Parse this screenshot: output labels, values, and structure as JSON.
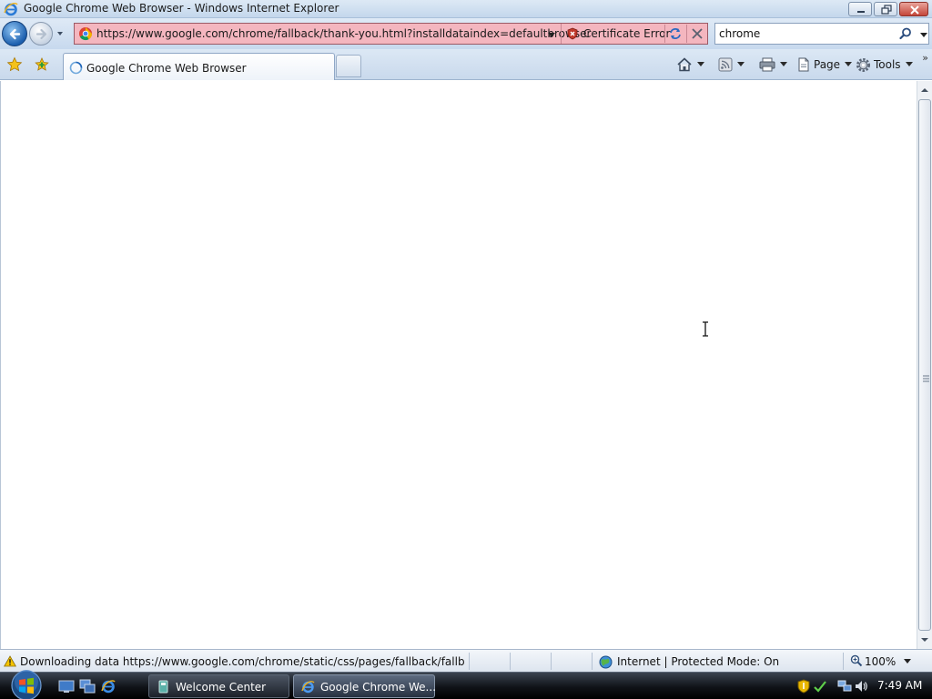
{
  "window": {
    "title": "Google Chrome Web Browser - Windows Internet Explorer"
  },
  "address_bar": {
    "url": "https://www.google.com/chrome/fallback/thank-you.html?installdataindex=defaultbrowser",
    "certificate_error_label": "Certificate Error",
    "background_color": "#f4b6bf"
  },
  "search": {
    "value": "chrome"
  },
  "tabs": [
    {
      "label": "Google Chrome Web Browser",
      "active": true
    }
  ],
  "command_bar": {
    "page_label": "Page",
    "tools_label": "Tools"
  },
  "status_bar": {
    "text": "Downloading data https://www.google.com/chrome/static/css/pages/fallback/fallback-thar",
    "zone": "Internet | Protected Mode: On",
    "zoom": "100%"
  },
  "taskbar": {
    "buttons": [
      {
        "label": "Welcome Center",
        "active": false
      },
      {
        "label": "Google Chrome We...",
        "active": true
      }
    ],
    "clock": "7:49 AM"
  }
}
